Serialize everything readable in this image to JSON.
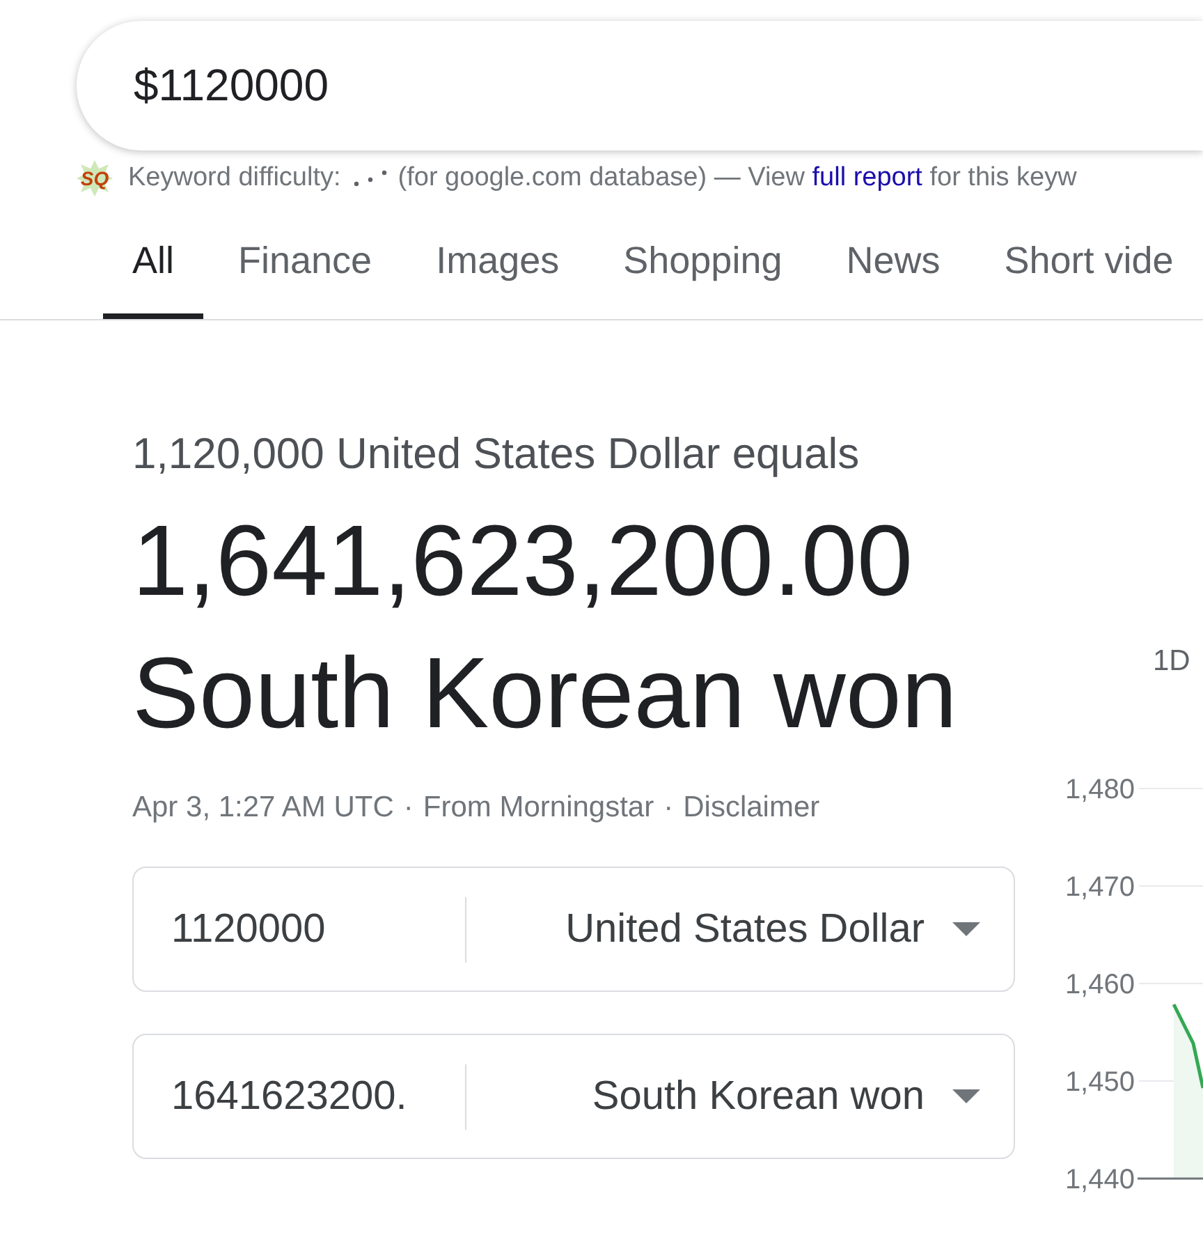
{
  "search": {
    "query": "$1120000"
  },
  "keyword_bar": {
    "logo": "SQ",
    "label": "Keyword difficulty:",
    "note": "(for google.com database) — View",
    "link": "full report",
    "note_end": "for this keyw"
  },
  "tabs": [
    {
      "label": "All",
      "selected": true
    },
    {
      "label": "Finance",
      "selected": false
    },
    {
      "label": "Images",
      "selected": false
    },
    {
      "label": "Shopping",
      "selected": false
    },
    {
      "label": "News",
      "selected": false
    },
    {
      "label": "Short vide",
      "selected": false
    }
  ],
  "converter": {
    "summary": "1,120,000 United States Dollar equals",
    "result_amount": "1,641,623,200.00",
    "result_currency": "South Korean won",
    "meta": [
      {
        "kind": "timestamp",
        "text": "Apr 3, 1:27 AM UTC"
      },
      {
        "kind": "separator",
        "text": "·"
      },
      {
        "kind": "source",
        "text": "From Morningstar"
      },
      {
        "kind": "separator",
        "text": "·"
      },
      {
        "kind": "link",
        "text": "Disclaimer"
      }
    ],
    "rows": [
      {
        "value": "1120000",
        "currency": "United States Dollar"
      },
      {
        "value": "1641623200.",
        "currency": "South Korean won"
      }
    ]
  },
  "chart": {
    "range_tabs": [
      {
        "label": "1D"
      }
    ],
    "y_axis_labels": [
      "1,480",
      "1,470",
      "1,460",
      "1,450",
      "1,440"
    ]
  }
}
